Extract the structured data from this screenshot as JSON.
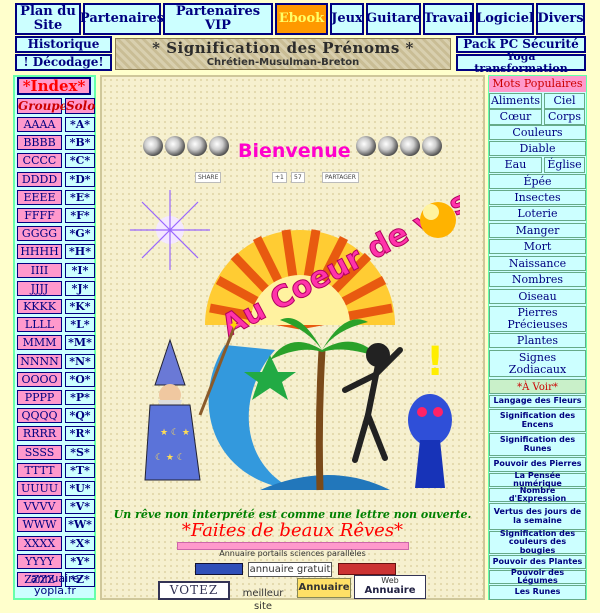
{
  "topnav": [
    {
      "label": "Plan du Site"
    },
    {
      "label": "Partenaires"
    },
    {
      "label": "Partenaires VIP"
    },
    {
      "label": "Ebook"
    },
    {
      "label": "Jeux"
    },
    {
      "label": "Guitare"
    },
    {
      "label": "Travail"
    },
    {
      "label": "Logiciel"
    },
    {
      "label": "Divers"
    }
  ],
  "subnav": {
    "historique": "Historique",
    "decodage": "! Décodage!",
    "pack": "Pack PC Sécurité",
    "yoga": "Yoga transformation"
  },
  "banner": {
    "title": "* Signification des Prénoms *",
    "subtitle": "Chrétien-Musulman-Breton"
  },
  "index": {
    "title": "*Index*",
    "groupe": "Groupe",
    "solo": "Solo",
    "rows": [
      [
        "AAAA",
        "*A*"
      ],
      [
        "BBBB",
        "*B*"
      ],
      [
        "CCCC",
        "*C*"
      ],
      [
        "DDDD",
        "*D*"
      ],
      [
        "EEEE",
        "*E*"
      ],
      [
        "FFFF",
        "*F*"
      ],
      [
        "GGGG",
        "*G*"
      ],
      [
        "HHHH",
        "*H*"
      ],
      [
        "IIII",
        "*I*"
      ],
      [
        "JJJJ",
        "*J*"
      ],
      [
        "KKKK",
        "*K*"
      ],
      [
        "LLLL",
        "*L*"
      ],
      [
        "MMM",
        "*M*"
      ],
      [
        "NNNN",
        "*N*"
      ],
      [
        "OOOO",
        "*O*"
      ],
      [
        "PPPP",
        "*P*"
      ],
      [
        "QQQQ",
        "*Q*"
      ],
      [
        "RRRR",
        "*R*"
      ],
      [
        "SSSS",
        "*S*"
      ],
      [
        "TTTT",
        "*T*"
      ],
      [
        "UUUU",
        "*U*"
      ],
      [
        "VVVV",
        "*V*"
      ],
      [
        "WWW",
        "*W*"
      ],
      [
        "XXXX",
        "*X*"
      ],
      [
        "YYYY",
        "*Y*"
      ],
      [
        "ZZZZ",
        "*Z*"
      ]
    ],
    "footer": "annuaire yopla.fr"
  },
  "center": {
    "bienvenue": "Bienvenue",
    "logo_text": "Au Coeur de vos Rêves",
    "slogan": "Un rêve non interprété est comme une lettre non ouverte.",
    "beaux": "*Faites de beaux Rêves*",
    "annuaire_portails": "Annuaire portails sciences parallèles",
    "share1": "SHARE",
    "share2": "PARTAGER",
    "count1": "+1",
    "count2": "57",
    "badges": {
      "votez": "VOTEZ",
      "gratuit": "annuaire gratuit",
      "meilleur": "meilleur site",
      "annuaire": "Annuaire",
      "web": "Web",
      "web_annuaire": "Annuaire"
    }
  },
  "right": {
    "mots": "Mots Populaires",
    "items_norm": [
      "Aliments",
      "Ciel",
      "Cœur",
      "Corps",
      "Couleurs",
      "Diable",
      "Eau",
      "Église",
      "Épée",
      "Insectes",
      "Loterie",
      "Manger",
      "Mort",
      "Naissance",
      "Nombres",
      "Oiseau",
      "Pierres Précieuses",
      "Plantes",
      "Signes Zodiacaux"
    ],
    "avoir": "*À Voir*",
    "items_small": [
      "Langage des Fleurs",
      "Signification des Encens",
      "Signification des Runes",
      "Pouvoir des Pierres",
      "La Pensée numérique",
      "Nombre d'Expression",
      "Vertus des jours de la semaine",
      "Signification des couleurs des bougies",
      "Pouvoir des Plantes",
      "Pouvoir des Légumes",
      "Les Runes"
    ]
  },
  "colors": {
    "accent": "#000080",
    "pink": "#ff99cc",
    "cyan": "#ccffff",
    "magenta": "#ff00cc",
    "ebook": "#ff9900"
  }
}
